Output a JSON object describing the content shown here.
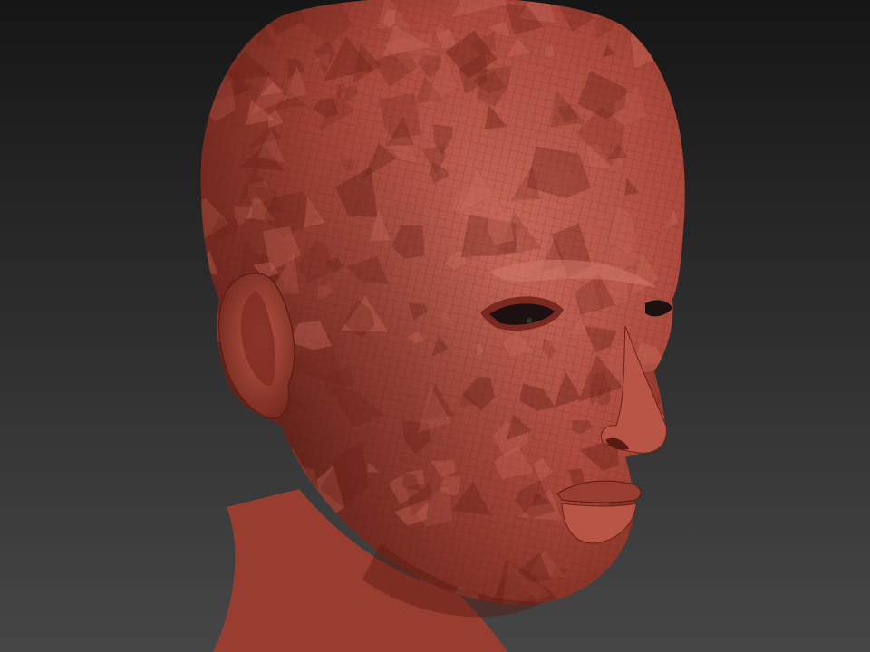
{
  "scene": {
    "subject": "sculpted-head",
    "background_top": "#161616",
    "background_bottom": "#464646",
    "skin_base": "#a8473a",
    "skin_light": "#c8695a",
    "skin_dark": "#6a2218",
    "eye_color": "#1c1010"
  }
}
